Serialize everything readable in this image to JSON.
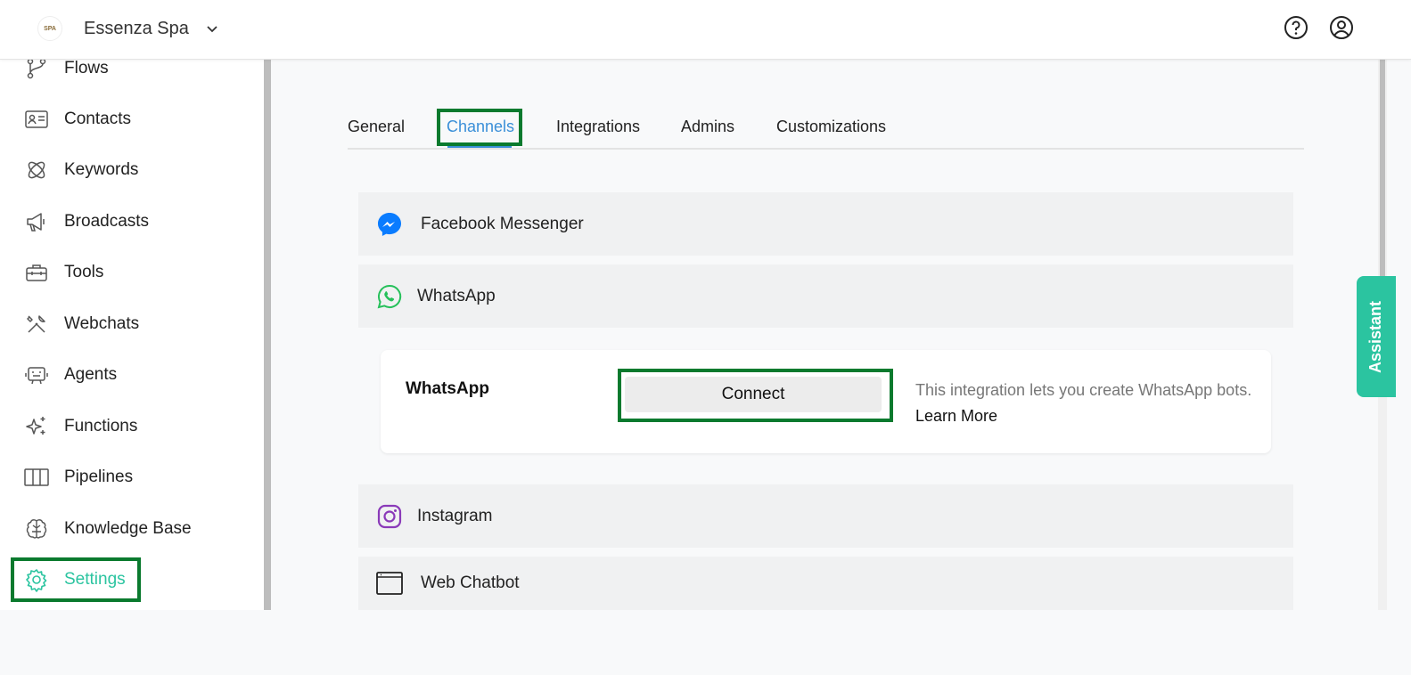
{
  "header": {
    "logo_text": "SPA",
    "org_name": "Essenza Spa"
  },
  "sidebar": {
    "items": [
      {
        "label": "Flows",
        "icon": "flows-icon"
      },
      {
        "label": "Contacts",
        "icon": "contact-card-icon"
      },
      {
        "label": "Keywords",
        "icon": "keywords-icon"
      },
      {
        "label": "Broadcasts",
        "icon": "megaphone-icon"
      },
      {
        "label": "Tools",
        "icon": "toolbox-icon"
      },
      {
        "label": "Webchats",
        "icon": "tools-wrench-icon"
      },
      {
        "label": "Agents",
        "icon": "agent-icon"
      },
      {
        "label": "Functions",
        "icon": "sparkles-icon"
      },
      {
        "label": "Pipelines",
        "icon": "columns-icon"
      },
      {
        "label": "Knowledge Base",
        "icon": "brain-icon"
      },
      {
        "label": "Settings",
        "icon": "gear-icon"
      }
    ],
    "active_item": "Settings"
  },
  "tabs": {
    "items": [
      "General",
      "Channels",
      "Integrations",
      "Admins",
      "Customizations"
    ],
    "active": "Channels"
  },
  "channels": {
    "facebook": "Facebook Messenger",
    "whatsapp": "WhatsApp",
    "instagram": "Instagram",
    "web_chatbot": "Web Chatbot"
  },
  "whatsapp_card": {
    "title": "WhatsApp",
    "connect_label": "Connect",
    "description": "This integration lets you create WhatsApp bots.",
    "learn_more": "Learn More"
  },
  "assistant": {
    "label": "Assistant"
  },
  "colors": {
    "accent_teal": "#2bc4a0",
    "tab_active_blue": "#3a8fd8",
    "highlight_green": "#0a7a2e"
  }
}
